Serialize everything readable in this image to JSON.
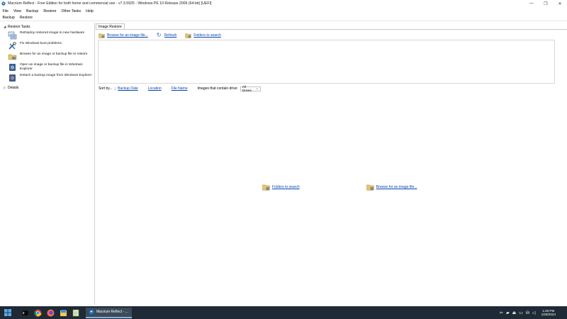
{
  "window": {
    "title": "Macrium Reflect - Free Edition for both home and commercial use - v7.3.5925 - Windows PE 10 Release 2009 (64-bit)  [UEFI]",
    "minimize": "—",
    "maximize": "❐",
    "close": "✕"
  },
  "menu": [
    "File",
    "View",
    "Backup",
    "Restore",
    "Other Tasks",
    "Help"
  ],
  "toolbar": [
    "Backup",
    "Restore"
  ],
  "left_pane": {
    "restore_tasks_header": "Restore Tasks",
    "details_header": "Details",
    "tasks": [
      {
        "label": "ReDeploy restored image to new hardware",
        "icon": "redeploy-icon"
      },
      {
        "label": "Fix Windows boot problems",
        "icon": "tools-icon"
      },
      {
        "label": "Browse for an image or backup file to restore",
        "icon": "folder-browse-icon"
      },
      {
        "label": "Open an image or backup file in Windows Explorer",
        "icon": "disk-open-icon"
      },
      {
        "label": "Detach a backup image from Windows Explorer",
        "icon": "disk-detach-icon"
      }
    ]
  },
  "main": {
    "tab_label": "Image Restore",
    "top_links": {
      "browse": "Browse for an image file...",
      "refresh": "Refresh",
      "folders": "Folders to search"
    },
    "sort": {
      "label": "Sort by...",
      "backup_date": "Backup Date",
      "location": "Location",
      "file_name": "File Name",
      "drive_label": "Images that contain drive:",
      "drive_value": "All Drives"
    },
    "center_links": {
      "folders": "Folders to search",
      "browse": "Browse for an image file..."
    }
  },
  "taskbar": {
    "active_task": "Macrium Reflect - ...",
    "time": "1:28 PM",
    "date": "1/28/2024"
  },
  "colors": {
    "link": "#0645ad",
    "taskbar": "#1f2a36",
    "accent_blue": "#2a6fb0"
  }
}
